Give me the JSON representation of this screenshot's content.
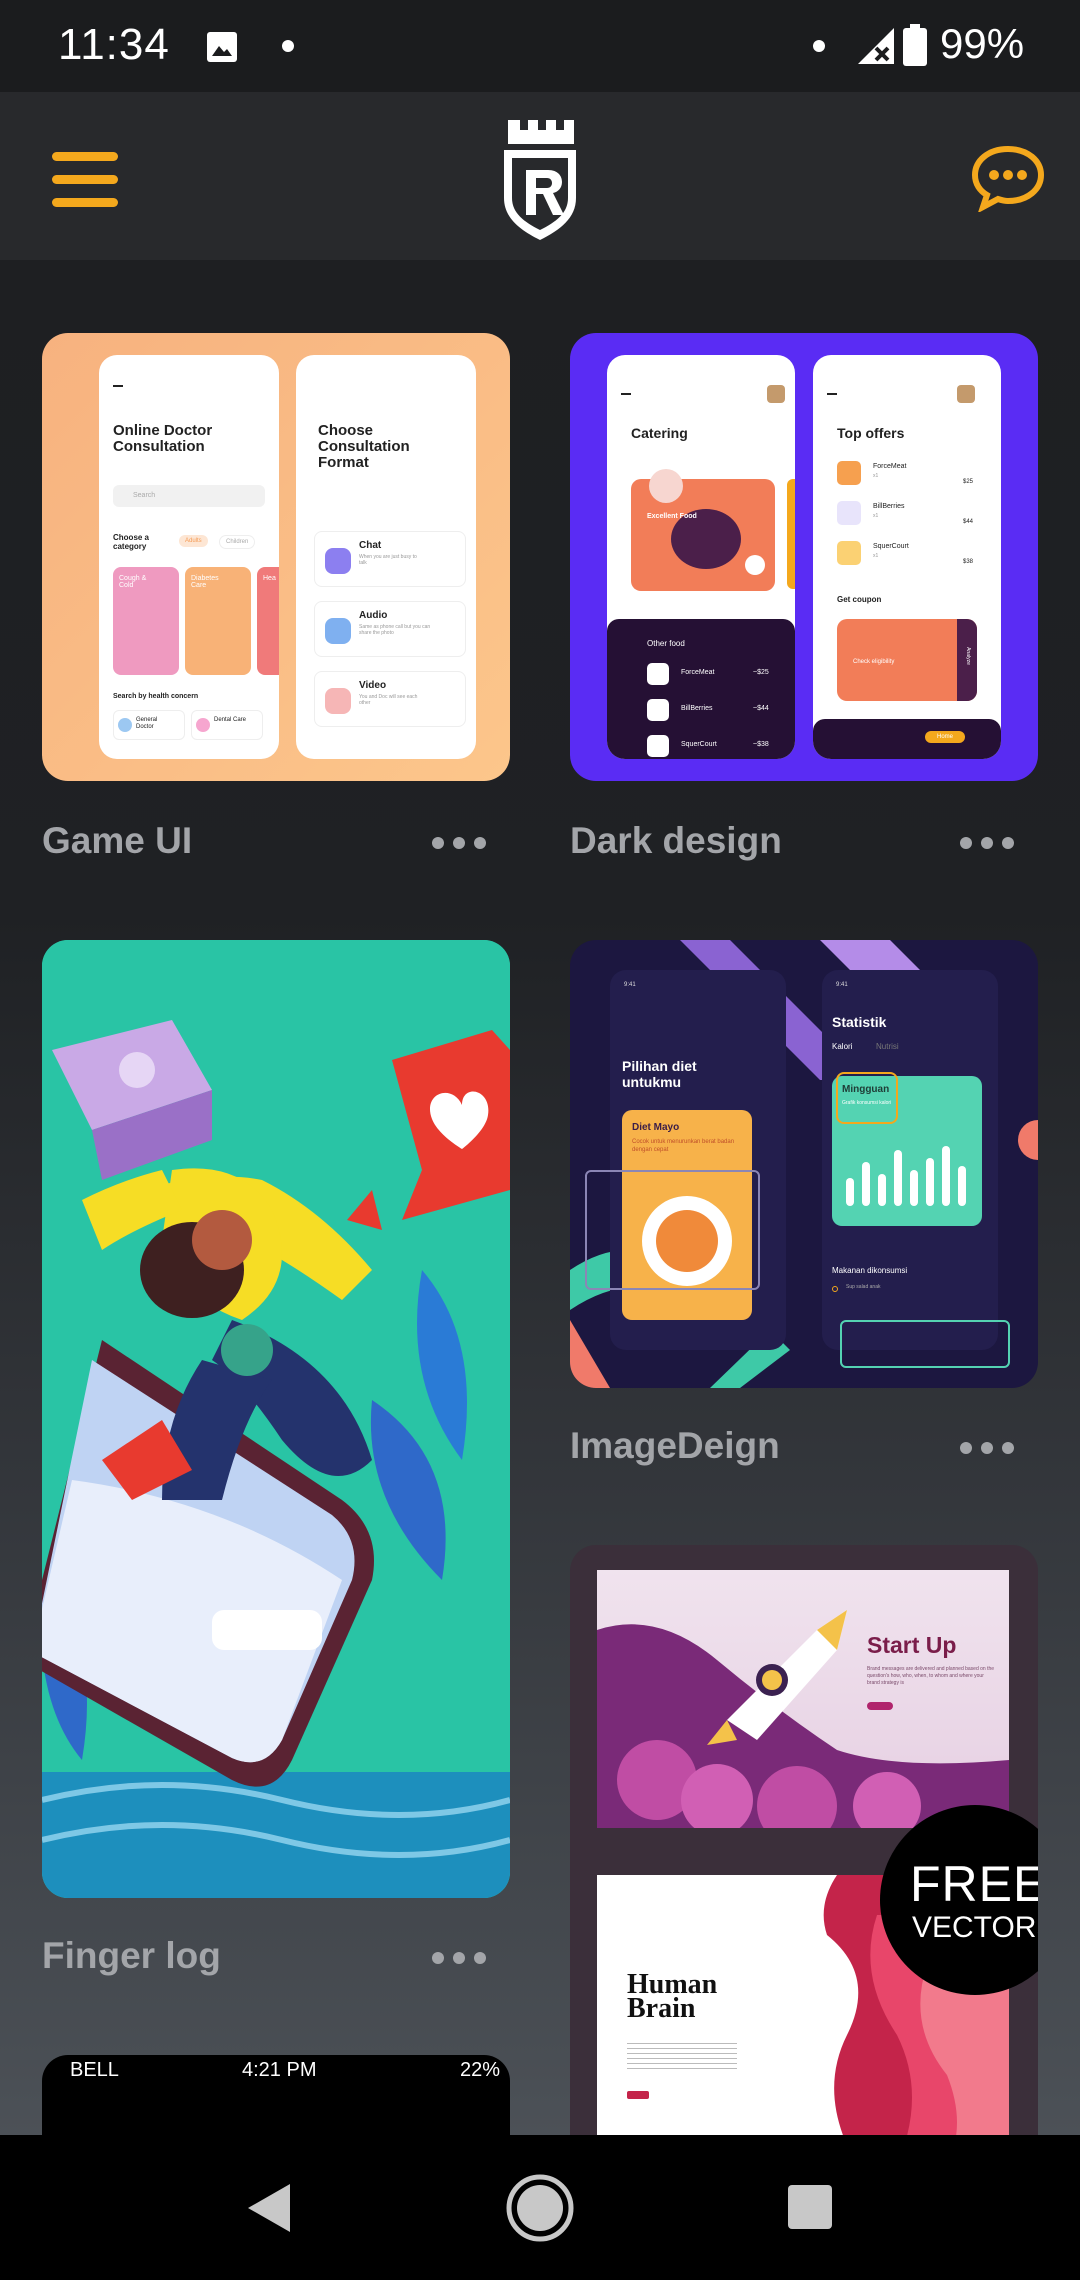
{
  "status_bar": {
    "time": "11:34",
    "battery": "99%"
  },
  "header": {
    "menu_icon": "hamburger-icon",
    "logo_icon": "castle-shield-logo",
    "chat_icon": "chat-bubble-icon",
    "accent": "#f4a81d"
  },
  "cards": [
    {
      "caption": "Game UI",
      "preview": {
        "screen1_title": "Online Doctor Consultation",
        "search_placeholder": "Search",
        "choose_category": "Choose a category",
        "pill_adults": "Adults",
        "pill_children": "Children",
        "tile_1": "Cough & Cold",
        "tile_2": "Diabetes Care",
        "tile_3": "Hea",
        "search_by": "Search by health concern",
        "concern_1": "General Doctor",
        "concern_2": "Dental Care",
        "screen2_title": "Choose Consultation Format",
        "options": [
          {
            "title": "Chat",
            "sub": "When you are just busy to talk"
          },
          {
            "title": "Audio",
            "sub": "Same as phone call but you can share the photo"
          },
          {
            "title": "Video",
            "sub": "You and Doc will see each other"
          }
        ]
      }
    },
    {
      "caption": "Dark design",
      "preview": {
        "screen1_title": "Catering",
        "featured": "Excellent Food",
        "other_food": "Other food",
        "foods": [
          {
            "name": "ForceMeat",
            "price": "~$25"
          },
          {
            "name": "BillBerries",
            "price": "~$44"
          },
          {
            "name": "SquerCourt",
            "price": "~$38"
          }
        ],
        "screen2_title": "Top offers",
        "offers": [
          {
            "name": "ForceMeat",
            "qty": "x1",
            "price": "$25"
          },
          {
            "name": "BillBerries",
            "qty": "x1",
            "price": "$44"
          },
          {
            "name": "SquerCourt",
            "qty": "x1",
            "price": "$38"
          }
        ],
        "coupon_title": "Get coupon",
        "coupon_card": "Check eligibility",
        "coupon_side": "Analyze",
        "nav_home": "Home"
      }
    },
    {
      "caption": "Finger log"
    },
    {
      "caption": "ImageDeign",
      "preview": {
        "phone_time": "9:41",
        "screen1_title": "Pilihan diet untukmu",
        "card_title": "Diet Mayo",
        "card_sub": "Cocok untuk menurunkan berat badan dengan cepat",
        "screen2_title": "Statistik",
        "tab_1": "Kalori",
        "tab_2": "Nutrisi",
        "period": "Mingguan",
        "period_sub": "Grafik konsumsi kalori",
        "bars": [
          0.35,
          0.55,
          0.4,
          0.7,
          0.45,
          0.6,
          0.75,
          0.5
        ],
        "section": "Makanan dikonsumsi",
        "item": "Sup salad anak"
      }
    },
    {
      "caption": "",
      "preview": {
        "title": "Start Up",
        "body": "Brand messages are delivered and planned based on the question's how, who, when, to whom and where your brand strategy is",
        "badge_1": "FREE",
        "badge_2": "VECTORS",
        "page2_title": "Human Brain"
      }
    },
    {
      "caption": "",
      "preview": {
        "carrier": "BELL",
        "time": "4:21 PM",
        "battery": "22%"
      }
    }
  ]
}
